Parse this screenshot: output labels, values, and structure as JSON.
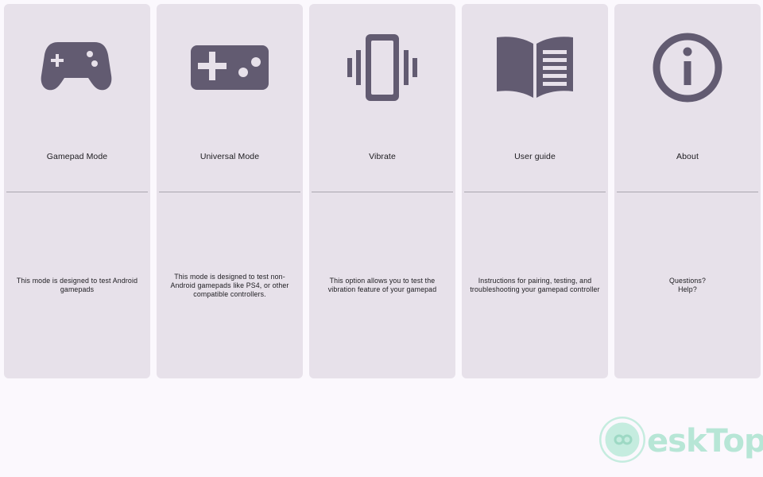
{
  "cards": [
    {
      "title": "Gamepad Mode",
      "description": "This mode is designed to test Android gamepads",
      "icon": "gamepad-icon"
    },
    {
      "title": "Universal Mode",
      "description": "This mode is designed to test non-Android gamepads like PS4, or other compatible controllers.",
      "icon": "controller-icon"
    },
    {
      "title": "Vibrate",
      "description": "This option allows you to test the vibration feature of your gamepad",
      "icon": "vibration-icon"
    },
    {
      "title": "User guide",
      "description": "Instructions for pairing, testing, and troubleshooting your gamepad controller",
      "icon": "book-icon"
    },
    {
      "title": "About",
      "description": "Questions?\nHelp?",
      "icon": "info-icon"
    }
  ],
  "watermark": {
    "text": "eskTop",
    "logo": "desktop-logo"
  },
  "colors": {
    "card": "#e7e1ea",
    "icon": "#625b71",
    "background": "#fbf8fd",
    "watermark": "#b7e6d6"
  }
}
